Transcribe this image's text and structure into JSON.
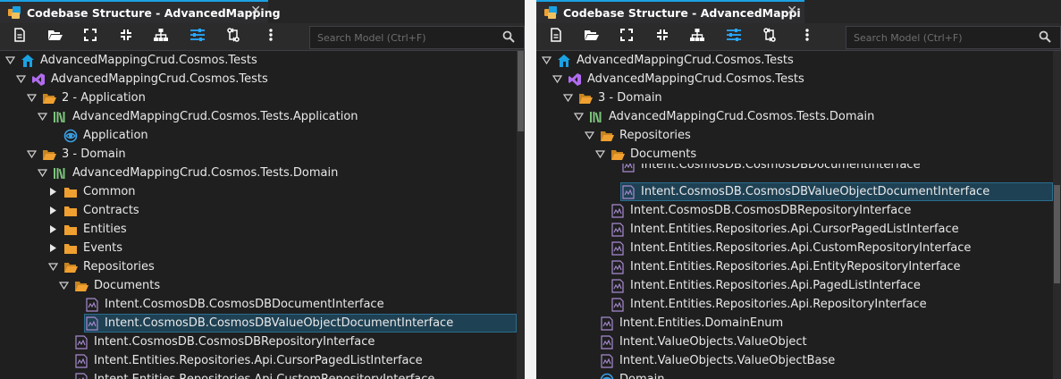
{
  "left": {
    "tab_title": "Codebase Structure - AdvancedMapping",
    "search_placeholder": "Search Model (Ctrl+F)",
    "rows": [
      {
        "label": "AdvancedMappingCrud.Cosmos.Tests",
        "icon": "house-icon",
        "arrow": "open",
        "indent": 0
      },
      {
        "label": "AdvancedMappingCrud.Cosmos.Tests",
        "icon": "visual-studio-icon",
        "arrow": "open",
        "indent": 1
      },
      {
        "label": "2 - Application",
        "icon": "folder-open-icon",
        "arrow": "open",
        "indent": 2
      },
      {
        "label": "AdvancedMappingCrud.Cosmos.Tests.Application",
        "icon": "library-icon",
        "arrow": "open",
        "indent": 3
      },
      {
        "label": "Application",
        "icon": "globe-icon",
        "arrow": "none",
        "indent": 4
      },
      {
        "label": "3 - Domain",
        "icon": "folder-open-icon",
        "arrow": "open",
        "indent": 2
      },
      {
        "label": "AdvancedMappingCrud.Cosmos.Tests.Domain",
        "icon": "library-icon",
        "arrow": "open",
        "indent": 3
      },
      {
        "label": "Common",
        "icon": "folder-icon",
        "arrow": "closed",
        "indent": 4
      },
      {
        "label": "Contracts",
        "icon": "folder-icon",
        "arrow": "closed",
        "indent": 4
      },
      {
        "label": "Entities",
        "icon": "folder-icon",
        "arrow": "closed",
        "indent": 4
      },
      {
        "label": "Events",
        "icon": "folder-icon",
        "arrow": "closed",
        "indent": 4
      },
      {
        "label": "Repositories",
        "icon": "folder-open-icon",
        "arrow": "open",
        "indent": 4
      },
      {
        "label": "Documents",
        "icon": "folder-open-icon",
        "arrow": "open",
        "indent": 5
      },
      {
        "label": "Intent.CosmosDB.CosmosDBDocumentInterface",
        "icon": "template-icon",
        "arrow": "none",
        "indent": 6
      },
      {
        "label": "Intent.CosmosDB.CosmosDBValueObjectDocumentInterface",
        "icon": "template-icon",
        "arrow": "none",
        "indent": 6,
        "selected": true
      },
      {
        "label": "Intent.CosmosDB.CosmosDBRepositoryInterface",
        "icon": "template-icon",
        "arrow": "none",
        "indent": 5
      },
      {
        "label": "Intent.Entities.Repositories.Api.CursorPagedListInterface",
        "icon": "template-icon",
        "arrow": "none",
        "indent": 5
      },
      {
        "label": "Intent.Entities.Repositories.Api.CustomRepositoryInterface",
        "icon": "template-icon",
        "arrow": "none",
        "indent": 5
      }
    ]
  },
  "right": {
    "tab_title": "Codebase Structure - AdvancedMappi",
    "search_placeholder": "Search Model (Ctrl+F)",
    "rows": [
      {
        "label": "AdvancedMappingCrud.Cosmos.Tests",
        "icon": "house-icon",
        "arrow": "open",
        "indent": 0
      },
      {
        "label": "AdvancedMappingCrud.Cosmos.Tests",
        "icon": "visual-studio-icon",
        "arrow": "open",
        "indent": 1
      },
      {
        "label": "3 - Domain",
        "icon": "folder-open-icon",
        "arrow": "open",
        "indent": 2
      },
      {
        "label": "AdvancedMappingCrud.Cosmos.Tests.Domain",
        "icon": "library-icon",
        "arrow": "open",
        "indent": 3
      },
      {
        "label": "Repositories",
        "icon": "folder-open-icon",
        "arrow": "open",
        "indent": 4
      },
      {
        "label": "Documents",
        "icon": "folder-open-icon",
        "arrow": "open",
        "indent": 5
      },
      {
        "label": "Intent.CosmosDB.CosmosDBDocumentInterface",
        "icon": "template-icon",
        "arrow": "none",
        "indent": 6
      },
      {
        "label": "Intent.CosmosDB.CosmosDBValueObjectDocumentInterface",
        "icon": "template-icon",
        "arrow": "none",
        "indent": 6,
        "selected": true
      },
      {
        "label": "Intent.CosmosDB.CosmosDBRepositoryInterface",
        "icon": "template-icon",
        "arrow": "none",
        "indent": 5
      },
      {
        "label": "Intent.Entities.Repositories.Api.CursorPagedListInterface",
        "icon": "template-icon",
        "arrow": "none",
        "indent": 5
      },
      {
        "label": "Intent.Entities.Repositories.Api.CustomRepositoryInterface",
        "icon": "template-icon",
        "arrow": "none",
        "indent": 5
      },
      {
        "label": "Intent.Entities.Repositories.Api.EntityRepositoryInterface",
        "icon": "template-icon",
        "arrow": "none",
        "indent": 5
      },
      {
        "label": "Intent.Entities.Repositories.Api.PagedListInterface",
        "icon": "template-icon",
        "arrow": "none",
        "indent": 5
      },
      {
        "label": "Intent.Entities.Repositories.Api.RepositoryInterface",
        "icon": "template-icon",
        "arrow": "none",
        "indent": 5
      },
      {
        "label": "Intent.Entities.DomainEnum",
        "icon": "template-icon",
        "arrow": "none",
        "indent": 4
      },
      {
        "label": "Intent.ValueObjects.ValueObject",
        "icon": "template-icon",
        "arrow": "none",
        "indent": 4
      },
      {
        "label": "Intent.ValueObjects.ValueObjectBase",
        "icon": "template-icon",
        "arrow": "none",
        "indent": 4
      },
      {
        "label": "Domain",
        "icon": "globe-icon",
        "arrow": "none",
        "indent": 4
      }
    ]
  },
  "toolbar_icons": [
    "new-file-icon",
    "open-folder-icon",
    "expand-icon",
    "collapse-icon",
    "hierarchy-icon",
    "filter-settings-icon",
    "sync-icon",
    "more-vertical-icon"
  ],
  "colors": {
    "accent": "#1ba1e2",
    "folder": "#f0a030",
    "library": "#7cc47c",
    "template": "#a78bd0",
    "selected": "#1f4154"
  }
}
